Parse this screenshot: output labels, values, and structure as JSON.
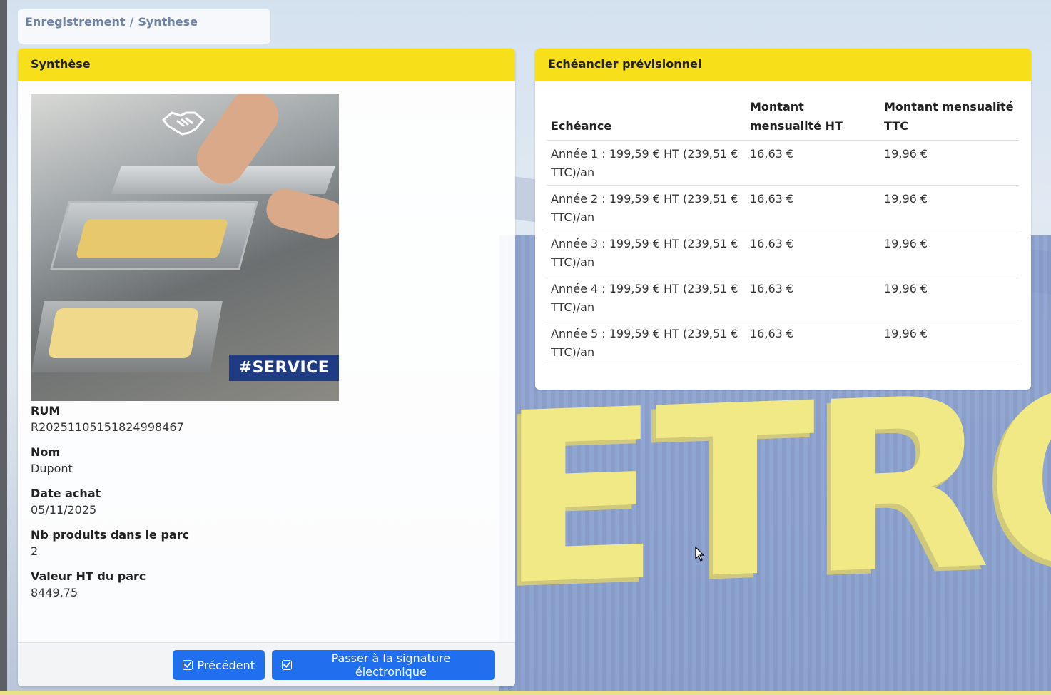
{
  "breadcrumb": {
    "part1": "Enregistrement",
    "separator": "/",
    "part2": "Synthese"
  },
  "summary": {
    "title": "Synthèse",
    "image_tag": "#SERVICE",
    "fields": [
      {
        "label": "RUM",
        "value": "R20251105151824998467"
      },
      {
        "label": "Nom",
        "value": "Dupont"
      },
      {
        "label": "Date achat",
        "value": "05/11/2025"
      },
      {
        "label": "Nb produits dans le parc",
        "value": "2"
      },
      {
        "label": "Valeur HT du parc",
        "value": "8449,75"
      }
    ],
    "buttons": {
      "previous": "Précédent",
      "next": "Passer à la signature électronique"
    }
  },
  "schedule": {
    "title": "Echéancier prévisionnel",
    "headers": [
      "Echéance",
      "Montant mensualité HT",
      "Montant mensualité TTC"
    ],
    "rows": [
      [
        "Année 1 : 199,59 € HT (239,51 € TTC)/an",
        "16,63 €",
        "19,96 €"
      ],
      [
        "Année 2 : 199,59 € HT (239,51 € TTC)/an",
        "16,63 €",
        "19,96 €"
      ],
      [
        "Année 3 : 199,59 € HT (239,51 € TTC)/an",
        "16,63 €",
        "19,96 €"
      ],
      [
        "Année 4 : 199,59 € HT (239,51 € TTC)/an",
        "16,63 €",
        "19,96 €"
      ],
      [
        "Année 5 : 199,59 € HT (239,51 € TTC)/an",
        "16,63 €",
        "19,96 €"
      ]
    ]
  },
  "background": {
    "sign_text": "ETRO"
  },
  "colors": {
    "header_yellow": "#f7e01a",
    "button_blue": "#1f6fee",
    "breadcrumb_text": "#6f82a8"
  }
}
